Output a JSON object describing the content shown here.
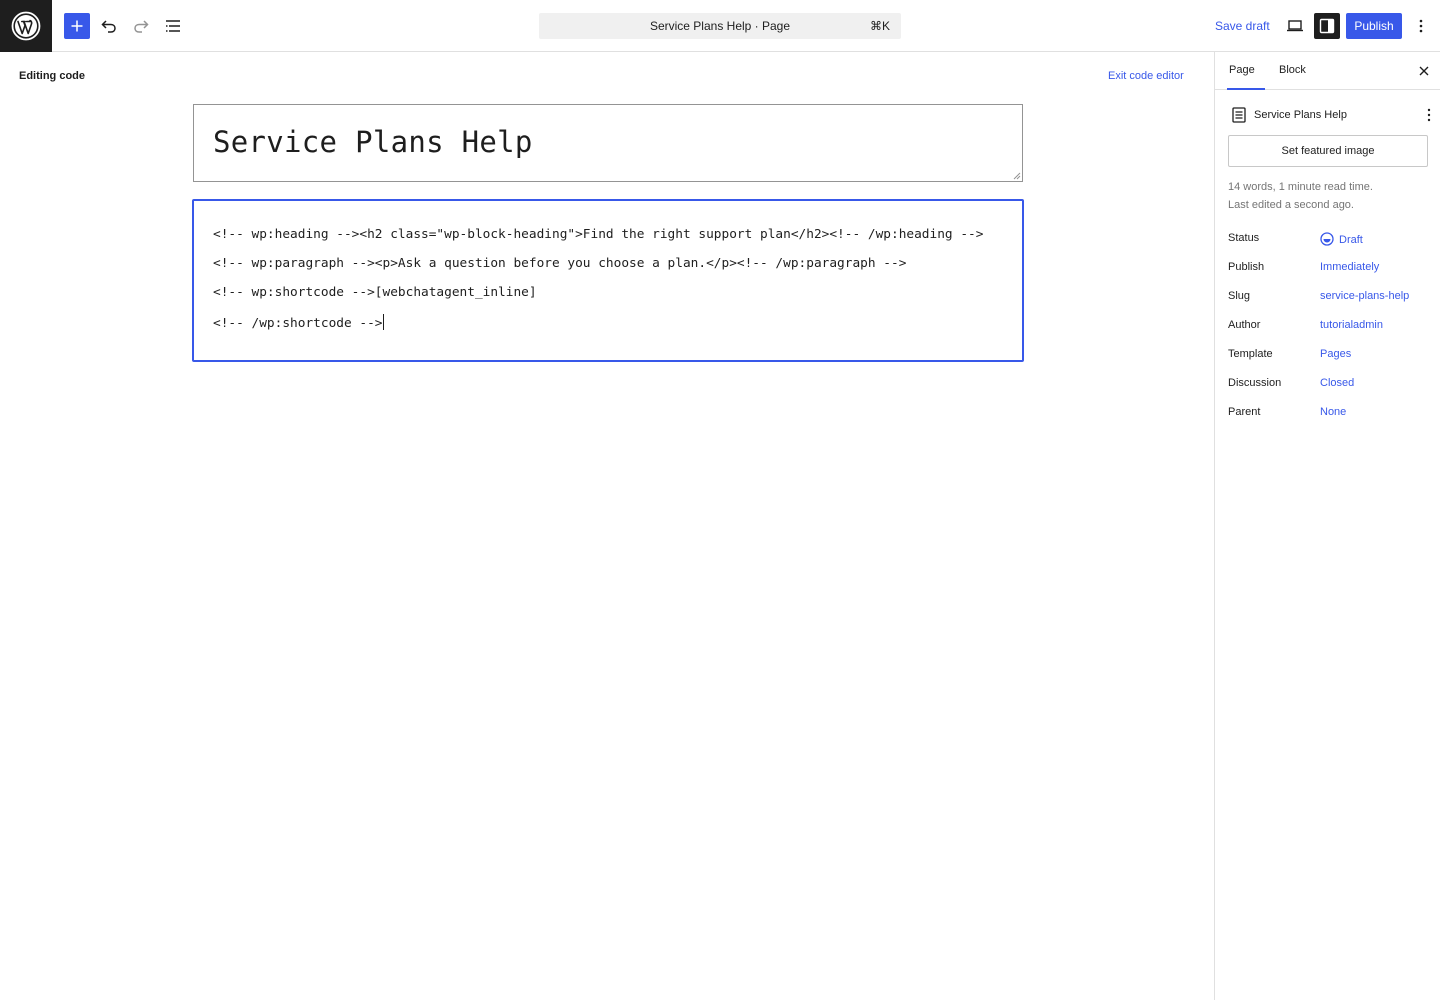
{
  "topbar": {
    "command_title": "Service Plans Help · Page",
    "command_shortcut": "⌘K",
    "save_draft": "Save draft",
    "publish": "Publish"
  },
  "editor": {
    "mode_label": "Editing code",
    "exit_label": "Exit code editor",
    "title": "Service Plans Help",
    "code_lines": [
      "<!-- wp:heading --><h2 class=\"wp-block-heading\">Find the right support plan</h2><!-- /wp:heading -->",
      "<!-- wp:paragraph --><p>Ask a question before you choose a plan.</p><!-- /wp:paragraph -->",
      "<!-- wp:shortcode -->[webchatagent_inline]",
      "<!-- /wp:shortcode -->"
    ]
  },
  "sidebar": {
    "tabs": [
      "Page",
      "Block"
    ],
    "doc_title": "Service Plans Help",
    "featured_image_button": "Set featured image",
    "word_count": "14 words, 1 minute read time.",
    "last_edited": "Last edited a second ago.",
    "properties": [
      {
        "label": "Status",
        "value": "Draft"
      },
      {
        "label": "Publish",
        "value": "Immediately"
      },
      {
        "label": "Slug",
        "value": "service-plans-help"
      },
      {
        "label": "Author",
        "value": "tutorialadmin"
      },
      {
        "label": "Template",
        "value": "Pages"
      },
      {
        "label": "Discussion",
        "value": "Closed"
      },
      {
        "label": "Parent",
        "value": "None"
      }
    ]
  },
  "colors": {
    "accent": "#3858e9",
    "dark": "#1e1e1e",
    "muted": "#757575"
  }
}
